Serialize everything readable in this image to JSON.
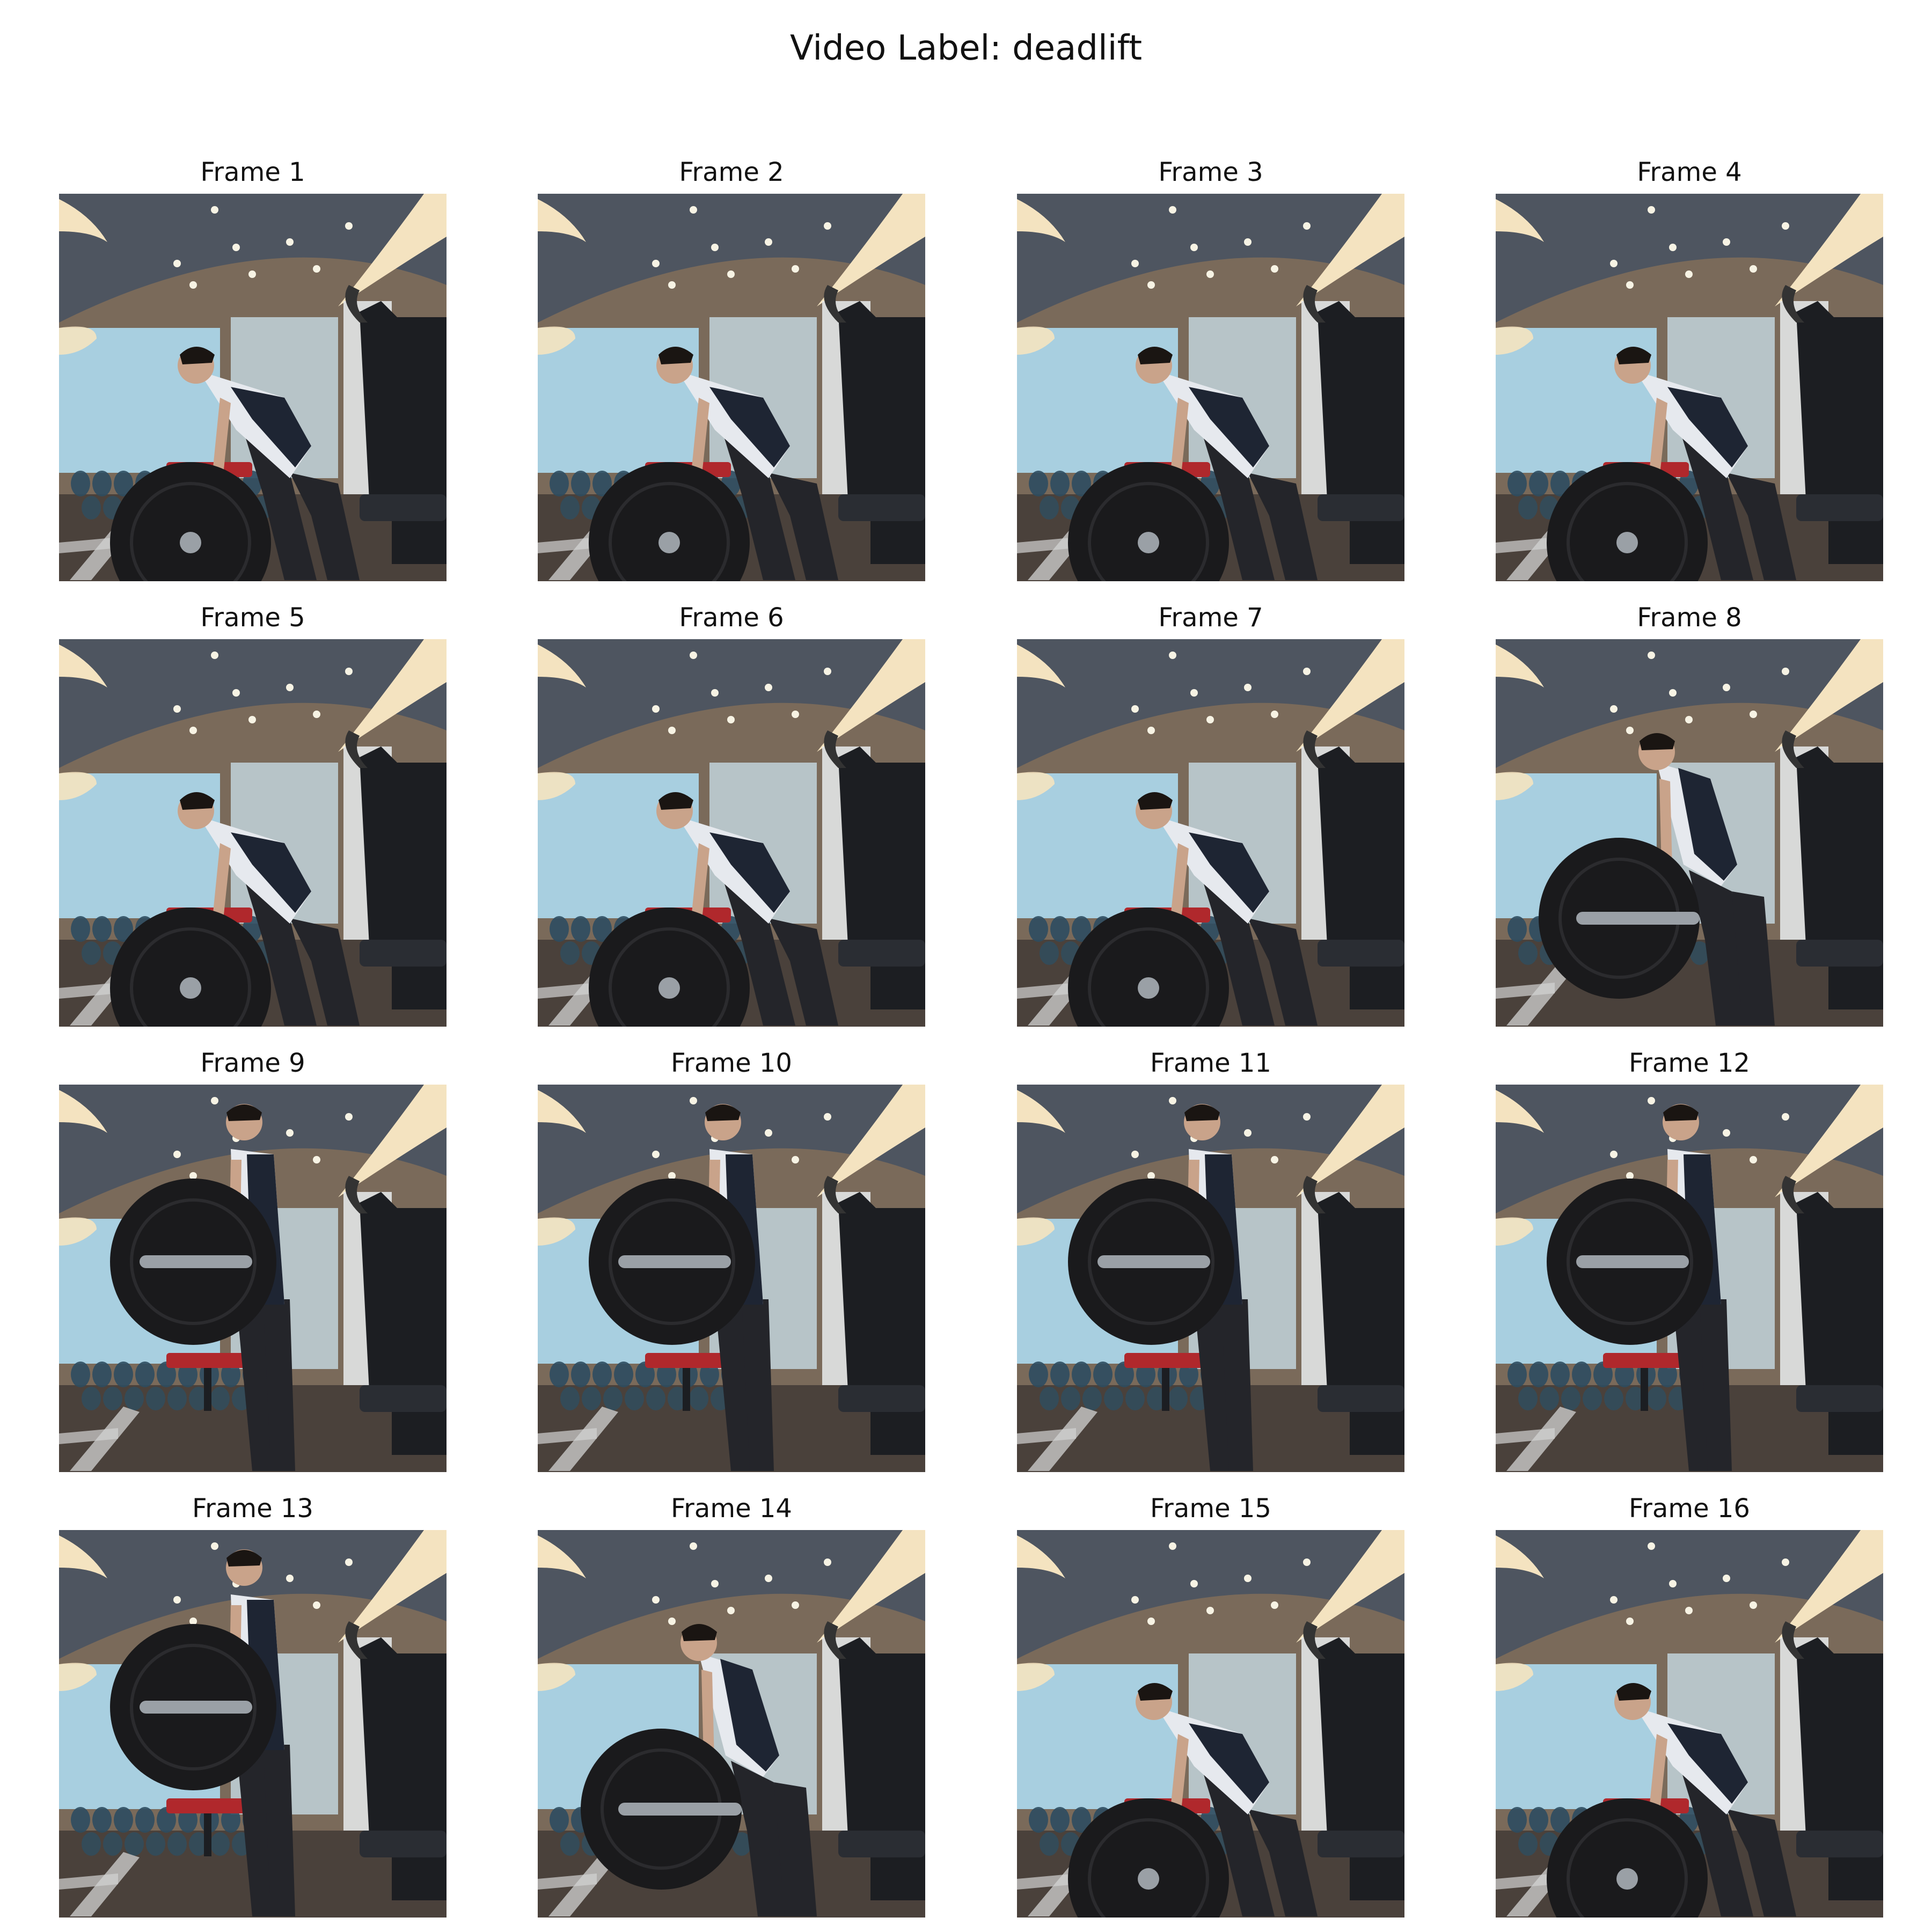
{
  "figure": {
    "title": "Video Label: deadlift"
  },
  "frames": [
    {
      "label": "Frame 1",
      "pose": "setup",
      "plate": "low"
    },
    {
      "label": "Frame 2",
      "pose": "setup",
      "plate": "low"
    },
    {
      "label": "Frame 3",
      "pose": "setup",
      "plate": "low"
    },
    {
      "label": "Frame 4",
      "pose": "setup",
      "plate": "low"
    },
    {
      "label": "Frame 5",
      "pose": "setup",
      "plate": "low"
    },
    {
      "label": "Frame 6",
      "pose": "setup",
      "plate": "low"
    },
    {
      "label": "Frame 7",
      "pose": "setup",
      "plate": "low"
    },
    {
      "label": "Frame 8",
      "pose": "rising",
      "plate": "mid"
    },
    {
      "label": "Frame 9",
      "pose": "lockout",
      "plate": "high"
    },
    {
      "label": "Frame 10",
      "pose": "lockout",
      "plate": "high"
    },
    {
      "label": "Frame 11",
      "pose": "lockout",
      "plate": "high"
    },
    {
      "label": "Frame 12",
      "pose": "lockout",
      "plate": "high"
    },
    {
      "label": "Frame 13",
      "pose": "lockout",
      "plate": "high"
    },
    {
      "label": "Frame 14",
      "pose": "rising",
      "plate": "mid"
    },
    {
      "label": "Frame 15",
      "pose": "setup",
      "plate": "low"
    },
    {
      "label": "Frame 16",
      "pose": "setup",
      "plate": "low"
    }
  ],
  "colors": {
    "ceiling": "#4e5560",
    "ceiling_light": "#f4e3c0",
    "window": "#a8cfe0",
    "wall": "#7a6a5a",
    "floor": "#4a413b",
    "machine": "#1c1e22",
    "bench_red": "#b0282c",
    "dumbbells": "#2e4d60",
    "plate": "#1a1a1c",
    "bar": "#9aa0a6",
    "person_skin": "#c9a38a",
    "person_shirt": "#e6e9ee",
    "person_vest": "#1e2533",
    "person_pants": "#24252a",
    "hair": "#1a1512"
  }
}
